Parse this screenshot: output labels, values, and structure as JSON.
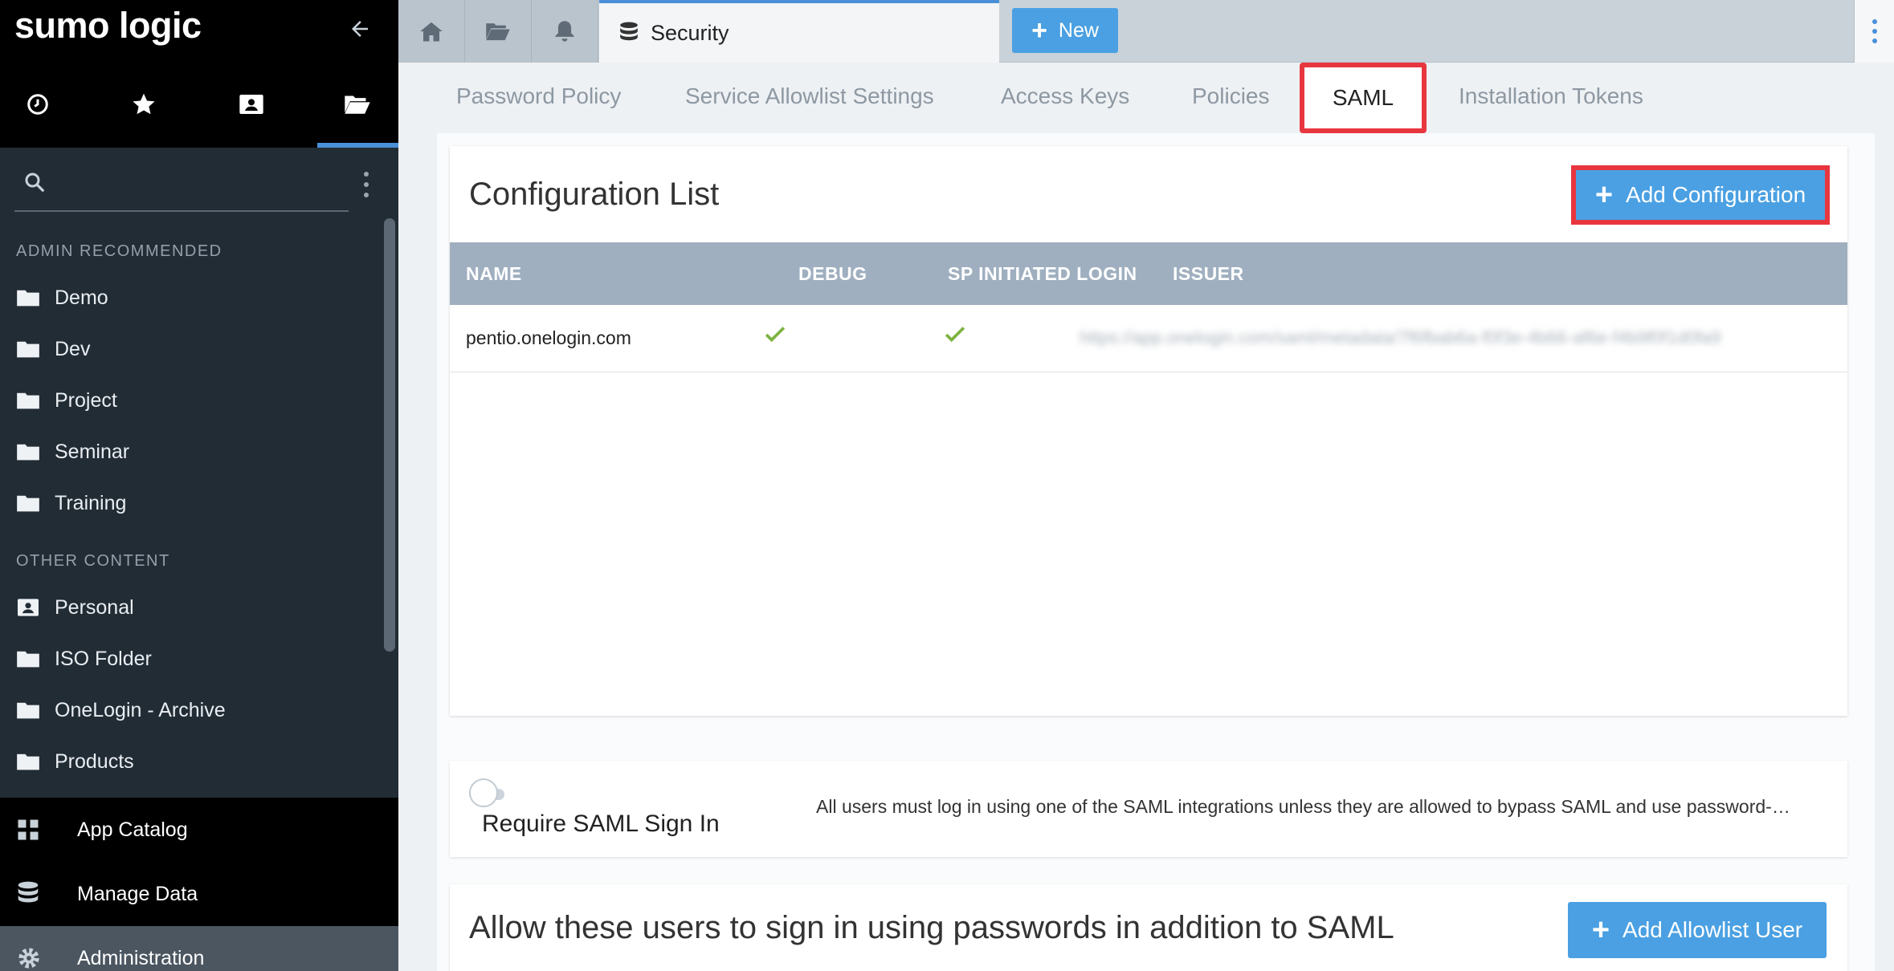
{
  "app": {
    "logo": "sumo logic"
  },
  "sidebar": {
    "nav_tabs": [
      {
        "icon": "clock-icon"
      },
      {
        "icon": "star-icon"
      },
      {
        "icon": "contact-folder-icon"
      },
      {
        "icon": "open-folder-icon",
        "active": true
      }
    ],
    "search": {
      "placeholder": "",
      "value": ""
    },
    "sections": [
      {
        "label": "ADMIN RECOMMENDED",
        "items": [
          "Demo",
          "Dev",
          "Project",
          "Seminar",
          "Training"
        ]
      },
      {
        "label": "OTHER CONTENT",
        "items": [
          "Personal",
          "ISO Folder",
          "OneLogin - Archive",
          "Products"
        ]
      }
    ],
    "bottom_nav": [
      "App Catalog",
      "Manage Data",
      "Administration"
    ]
  },
  "topbar": {
    "active_tab": "Security",
    "new_button": "New"
  },
  "subtabs": [
    "Password Policy",
    "Service Allowlist Settings",
    "Access Keys",
    "Policies",
    "SAML",
    "Installation Tokens"
  ],
  "active_subtab": "SAML",
  "config": {
    "title": "Configuration List",
    "add_button": "Add Configuration",
    "columns": [
      "NAME",
      "DEBUG",
      "SP INITIATED LOGIN",
      "ISSUER"
    ],
    "rows": [
      {
        "name": "pentio.onelogin.com",
        "debug": true,
        "sp_initiated_login": true,
        "issuer": "https://app.onelogin.com/saml/metadata/7f6fbab6a-f0f3e-4b66-af6e-f4b9f0f1d0fa9"
      }
    ]
  },
  "require_saml": {
    "label": "Require SAML Sign In",
    "enabled": false,
    "description": "All users must log in using one of the SAML integrations unless they are allowed to bypass SAML and use password-…"
  },
  "allowlist": {
    "title": "Allow these users to sign in using passwords in addition to SAML",
    "add_button": "Add Allowlist User"
  },
  "colors": {
    "accent": "#4a90d9",
    "button": "#4aa0e2",
    "highlight": "#e8363f",
    "check": "#7cb342",
    "table_header": "#9fafc0"
  }
}
